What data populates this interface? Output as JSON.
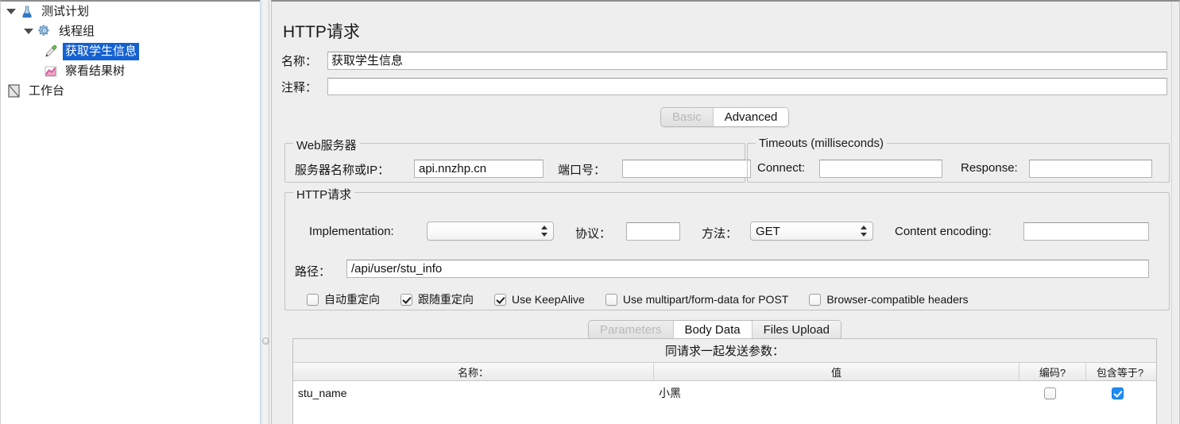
{
  "tree": {
    "items": [
      {
        "label": "测试计划",
        "icon": "flask-icon",
        "indent": 1,
        "twisty": true,
        "selected": false
      },
      {
        "label": "线程组",
        "icon": "gear-icon",
        "indent": 2,
        "twisty": true,
        "selected": false
      },
      {
        "label": "获取学生信息",
        "icon": "pipette-icon",
        "indent": 3,
        "twisty": false,
        "selected": true
      },
      {
        "label": "察看结果树",
        "icon": "chart-icon",
        "indent": 3,
        "twisty": false,
        "selected": false
      },
      {
        "label": "工作台",
        "icon": "page-icon",
        "indent": 0,
        "twisty": false,
        "selected": false
      }
    ]
  },
  "panel": {
    "title": "HTTP请求",
    "name_label": "名称：",
    "name_value": "获取学生信息",
    "comment_label": "注释：",
    "comment_value": ""
  },
  "main_tabs": [
    {
      "label": "Basic",
      "state": "dim"
    },
    {
      "label": "Advanced",
      "state": "selected"
    }
  ],
  "web_server": {
    "title": "Web服务器",
    "host_label": "服务器名称或IP：",
    "host_value": "api.nnzhp.cn",
    "port_label": "端口号：",
    "port_value": ""
  },
  "timeouts": {
    "title": "Timeouts (milliseconds)",
    "connect_label": "Connect:",
    "connect_value": "",
    "response_label": "Response:",
    "response_value": ""
  },
  "http_request": {
    "title": "HTTP请求",
    "implementation_label": "Implementation:",
    "implementation_value": "",
    "protocol_label": "协议：",
    "protocol_value": "",
    "method_label": "方法：",
    "method_value": "GET",
    "content_encoding_label": "Content encoding:",
    "content_encoding_value": "",
    "path_label": "路径：",
    "path_value": "/api/user/stu_info",
    "checkboxes": [
      {
        "label": "自动重定向",
        "checked": false
      },
      {
        "label": "跟随重定向",
        "checked": true
      },
      {
        "label": "Use KeepAlive",
        "checked": true
      },
      {
        "label": "Use multipart/form-data for POST",
        "checked": false
      },
      {
        "label": "Browser-compatible headers",
        "checked": false
      }
    ]
  },
  "param_tabs": [
    {
      "label": "Parameters",
      "state": "dim"
    },
    {
      "label": "Body Data",
      "state": "selected"
    },
    {
      "label": "Files Upload",
      "state": "normal"
    }
  ],
  "parameters": {
    "caption": "同请求一起发送参数：",
    "columns": [
      "名称：",
      "值",
      "编码?",
      "包含等于?"
    ],
    "rows": [
      {
        "name": "stu_name",
        "value": "小黑",
        "encode": false,
        "include_equals": true
      }
    ]
  },
  "colors": {
    "selection_blue": "#1461d2",
    "checkbox_blue": "#1f8cf5",
    "panel_bg": "#eeeeee"
  }
}
